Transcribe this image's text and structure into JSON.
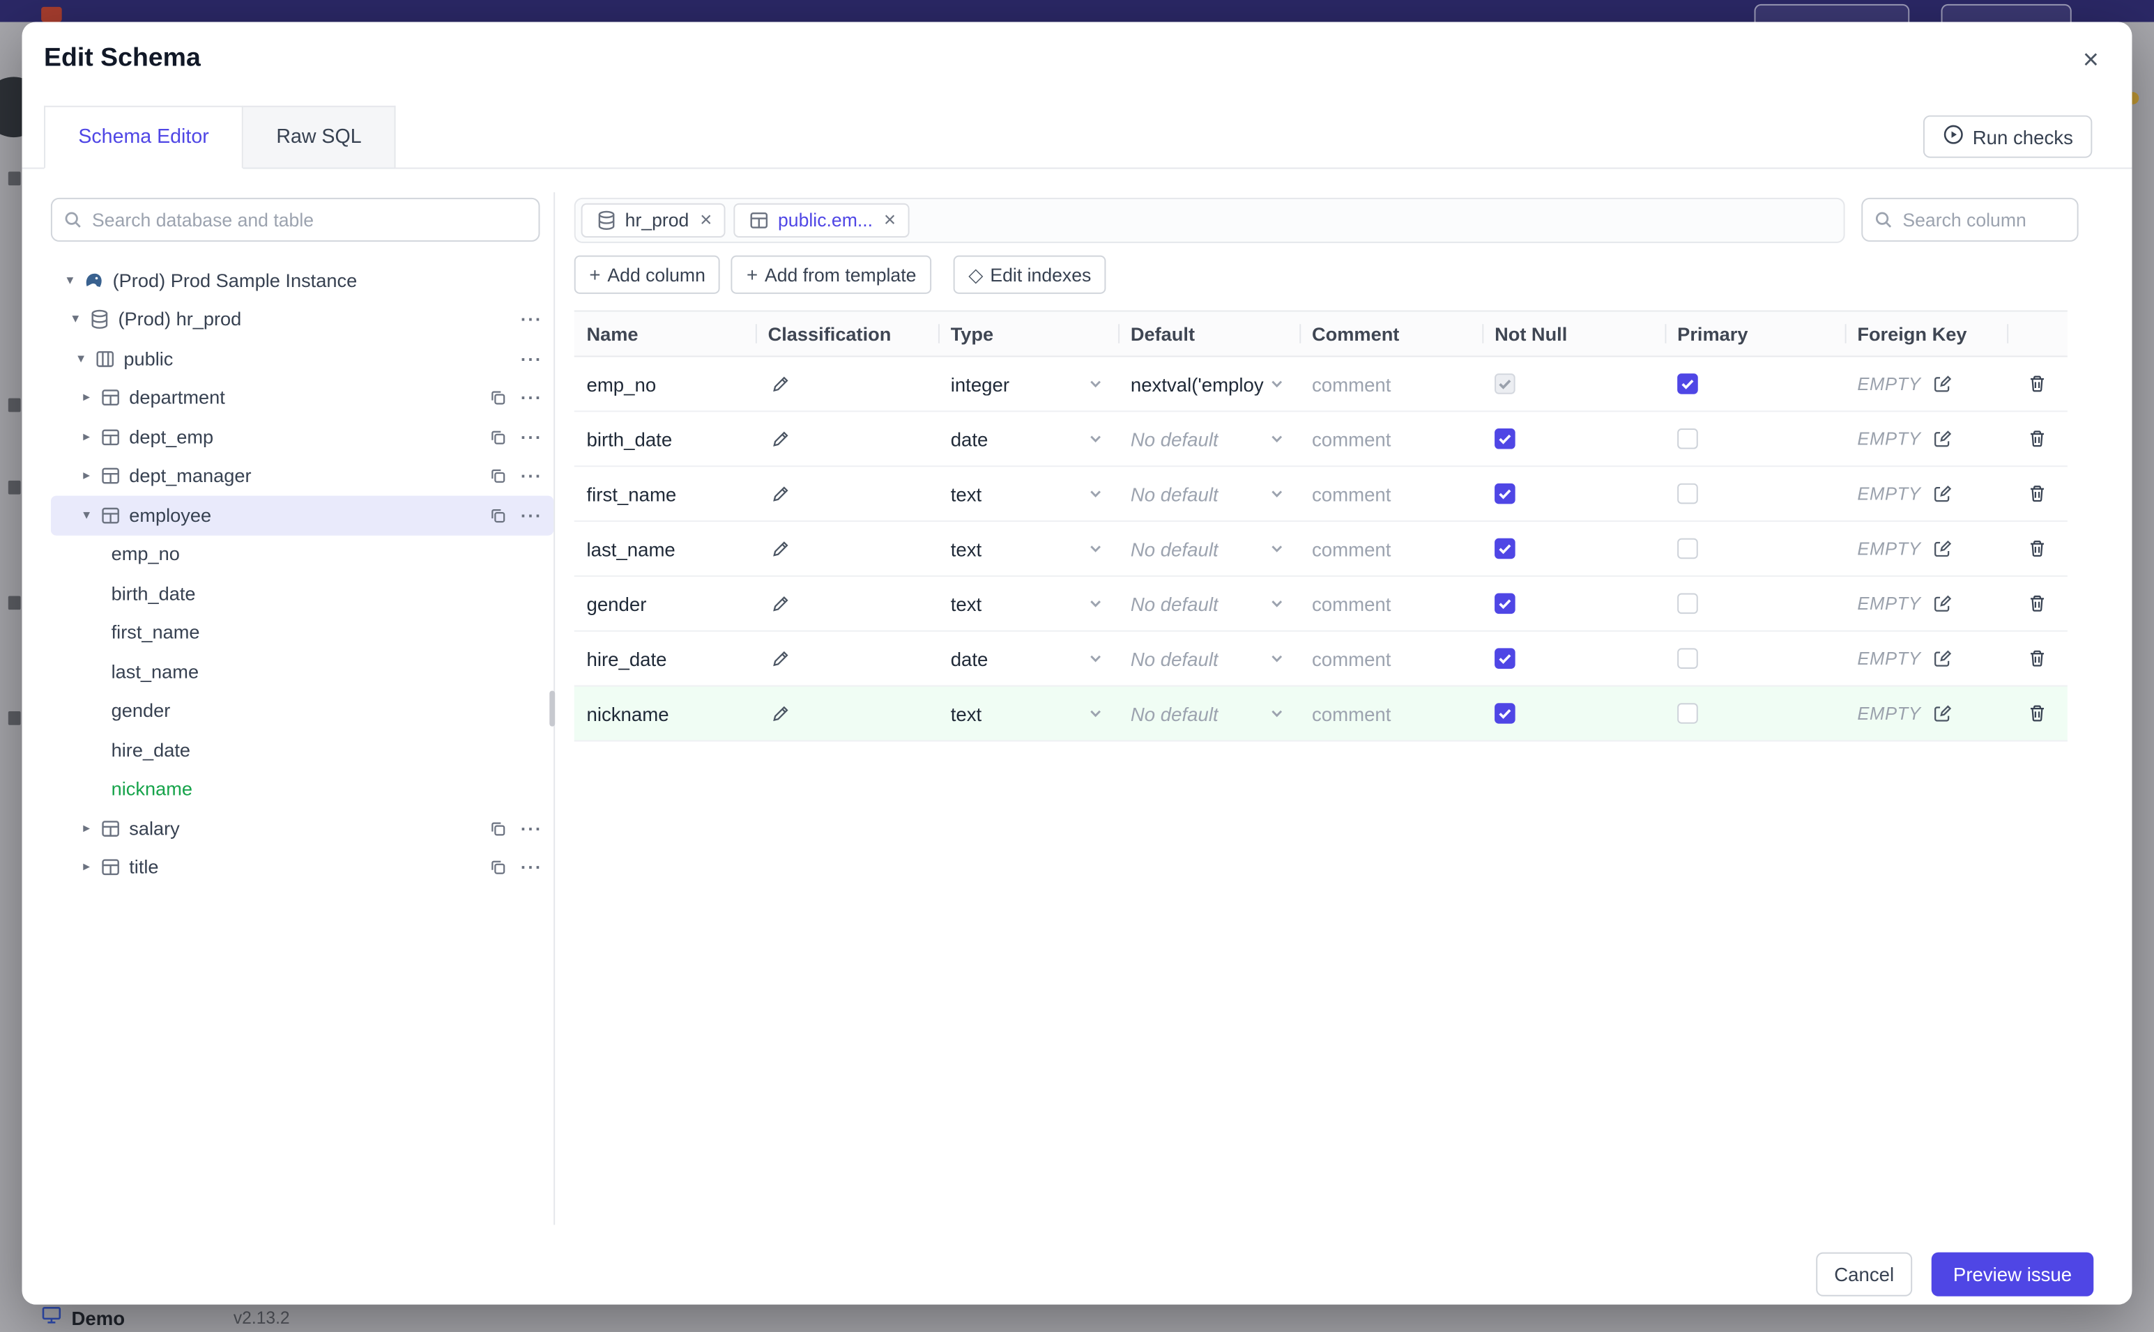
{
  "chrome": {
    "demo_label": "Demo",
    "version": "v2.13.2"
  },
  "modal": {
    "title": "Edit Schema",
    "close_glyph": "×",
    "tabs": [
      {
        "label": "Schema Editor",
        "active": true
      },
      {
        "label": "Raw SQL",
        "active": false
      }
    ],
    "run_checks_label": "Run checks",
    "sidebar": {
      "search_placeholder": "Search database and table",
      "tree": [
        {
          "label": "(Prod) Prod Sample Instance",
          "icon": "instance",
          "caret": "down",
          "indent": 0
        },
        {
          "label": "(Prod) hr_prod",
          "icon": "database",
          "caret": "down",
          "indent": 1,
          "more": true
        },
        {
          "label": "public",
          "icon": "schema",
          "caret": "down",
          "indent": 2,
          "more": true
        },
        {
          "label": "department",
          "icon": "table",
          "caret": "right",
          "indent": 3,
          "copy": true,
          "more": true
        },
        {
          "label": "dept_emp",
          "icon": "table",
          "caret": "right",
          "indent": 3,
          "copy": true,
          "more": true
        },
        {
          "label": "dept_manager",
          "icon": "table",
          "caret": "right",
          "indent": 3,
          "copy": true,
          "more": true
        },
        {
          "label": "employee",
          "icon": "table",
          "caret": "down",
          "indent": 3,
          "copy": true,
          "more": true,
          "selected": true
        },
        {
          "label": "emp_no",
          "indent": "col"
        },
        {
          "label": "birth_date",
          "indent": "col"
        },
        {
          "label": "first_name",
          "indent": "col"
        },
        {
          "label": "last_name",
          "indent": "col"
        },
        {
          "label": "gender",
          "indent": "col"
        },
        {
          "label": "hire_date",
          "indent": "col"
        },
        {
          "label": "nickname",
          "indent": "col",
          "added": true
        },
        {
          "label": "salary",
          "icon": "table",
          "caret": "right",
          "indent": 3,
          "copy": true,
          "more": true
        },
        {
          "label": "title",
          "icon": "table",
          "caret": "right",
          "indent": 3,
          "copy": true,
          "more": true
        }
      ]
    },
    "editor": {
      "chips": [
        {
          "label": "hr_prod",
          "icon": "database",
          "active": false
        },
        {
          "label": "public.em...",
          "icon": "table",
          "active": true
        }
      ],
      "column_search_placeholder": "Search column",
      "toolbar": [
        {
          "label": "Add column",
          "icon": "plus-icon",
          "icon_char": "+"
        },
        {
          "label": "Add from template",
          "icon": "plus-icon",
          "icon_char": "+"
        },
        {
          "label": "Edit indexes",
          "icon": "diamond-icon",
          "icon_char": "◇"
        }
      ],
      "table": {
        "headers": [
          "Name",
          "Classification",
          "Type",
          "Default",
          "Comment",
          "Not Null",
          "Primary",
          "Foreign Key",
          ""
        ],
        "comment_placeholder": "comment",
        "fk_empty_label": "EMPTY",
        "rows": [
          {
            "name": "emp_no",
            "type": "integer",
            "default": "nextval('employ",
            "default_is_placeholder": false,
            "not_null_checked": true,
            "not_null_disabled": true,
            "primary_checked": true,
            "highlight": false
          },
          {
            "name": "birth_date",
            "type": "date",
            "default": "No default",
            "default_is_placeholder": true,
            "not_null_checked": true,
            "not_null_disabled": false,
            "primary_checked": false,
            "highlight": false
          },
          {
            "name": "first_name",
            "type": "text",
            "default": "No default",
            "default_is_placeholder": true,
            "not_null_checked": true,
            "not_null_disabled": false,
            "primary_checked": false,
            "highlight": false
          },
          {
            "name": "last_name",
            "type": "text",
            "default": "No default",
            "default_is_placeholder": true,
            "not_null_checked": true,
            "not_null_disabled": false,
            "primary_checked": false,
            "highlight": false
          },
          {
            "name": "gender",
            "type": "text",
            "default": "No default",
            "default_is_placeholder": true,
            "not_null_checked": true,
            "not_null_disabled": false,
            "primary_checked": false,
            "highlight": false
          },
          {
            "name": "hire_date",
            "type": "date",
            "default": "No default",
            "default_is_placeholder": true,
            "not_null_checked": true,
            "not_null_disabled": false,
            "primary_checked": false,
            "highlight": false
          },
          {
            "name": "nickname",
            "type": "text",
            "default": "No default",
            "default_is_placeholder": true,
            "not_null_checked": true,
            "not_null_disabled": false,
            "primary_checked": false,
            "highlight": true
          }
        ]
      },
      "footer": {
        "cancel_label": "Cancel",
        "primary_label": "Preview issue"
      }
    }
  },
  "colors": {
    "accent": "#4f46e5",
    "added_green": "#16a34a",
    "row_highlight": "#f0fdf4",
    "topbar": "#2b2866"
  }
}
